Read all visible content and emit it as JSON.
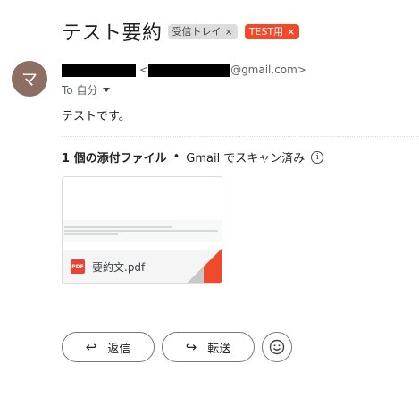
{
  "email": {
    "subject": "テスト要約",
    "labels": [
      {
        "text": "受信トレイ",
        "remove": "×"
      },
      {
        "text": "TEST用",
        "remove": "×"
      }
    ],
    "avatar_letter": "マ",
    "sender_email_suffix": "@gmail.com>",
    "sender_email_prefix": "<",
    "to_label": "To 自分",
    "body": "テストです。"
  },
  "attachments": {
    "count_text": "1 個の添付ファイル",
    "separator": "•",
    "scan_text": "Gmail でスキャン済み",
    "info_glyph": "i",
    "files": [
      {
        "name": "要約文.pdf",
        "type_badge": "PDF"
      }
    ]
  },
  "actions": {
    "reply_label": "返信",
    "forward_label": "転送",
    "reply_icon": "↩",
    "forward_icon": "↪"
  },
  "colors": {
    "test_label": "#f04a2b",
    "avatar": "#8d6e63",
    "pdf_red": "#ea4335"
  }
}
